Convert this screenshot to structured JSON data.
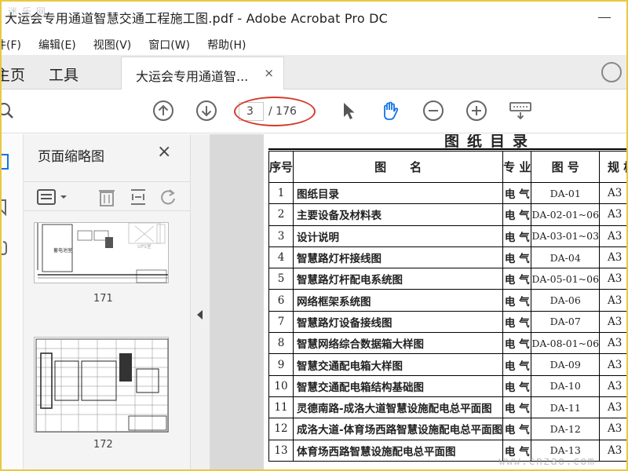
{
  "window": {
    "title": "大运会专用通道智慧交通工程施工图.pdf - Adobe Acrobat Pro DC"
  },
  "menu": [
    "件(F)",
    "编辑(E)",
    "视图(V)",
    "窗口(W)",
    "帮助(H)"
  ],
  "tabs": {
    "home": "主页",
    "tools": "工具",
    "document": "大运会专用通道智...",
    "close": "×"
  },
  "toolbar": {
    "page_current": "3",
    "page_total": "/ 176"
  },
  "thumbnails": {
    "title": "页面缩略图",
    "close": "×",
    "pages": [
      {
        "number": "171",
        "label": "蓄电池室",
        "label2": "UPS室"
      },
      {
        "number": "172"
      }
    ]
  },
  "document": {
    "heading": "图纸目录",
    "columns": [
      "序号",
      "图　　名",
      "专 业",
      "图 号",
      "规 格"
    ],
    "rows": [
      [
        "1",
        "图纸目录",
        "电 气",
        "DA-01",
        "A3"
      ],
      [
        "2",
        "主要设备及材料表",
        "电 气",
        "DA-02-01~06",
        "A3"
      ],
      [
        "3",
        "设计说明",
        "电 气",
        "DA-03-01~03",
        "A3"
      ],
      [
        "4",
        "智慧路灯杆接线图",
        "电 气",
        "DA-04",
        "A3"
      ],
      [
        "5",
        "智慧路灯杆配电系统图",
        "电 气",
        "DA-05-01~06",
        "A3"
      ],
      [
        "6",
        "网络框架系统图",
        "电 气",
        "DA-06",
        "A3"
      ],
      [
        "7",
        "智慧路灯设备接线图",
        "电 气",
        "DA-07",
        "A3"
      ],
      [
        "8",
        "智慧网络综合数据箱大样图",
        "电 气",
        "DA-08-01~06",
        "A3"
      ],
      [
        "9",
        "智慧交通配电箱大样图",
        "电 气",
        "DA-09",
        "A3"
      ],
      [
        "10",
        "智慧交通配电箱结构基础图",
        "电 气",
        "DA-10",
        "A3"
      ],
      [
        "11",
        "灵德南路-成洛大道智慧设施配电总平面图",
        "电 气",
        "DA-11",
        "A3"
      ],
      [
        "12",
        "成洛大道-体育场西路智慧设施配电总平面图",
        "电 气",
        "DA-12",
        "A3"
      ],
      [
        "13",
        "体育场西路智慧设施配电总平面图",
        "电 气",
        "DA-13",
        "A3"
      ]
    ]
  },
  "watermarks": {
    "top_left": "迷乐网",
    "bottom_right": "www.cnzao.com"
  }
}
